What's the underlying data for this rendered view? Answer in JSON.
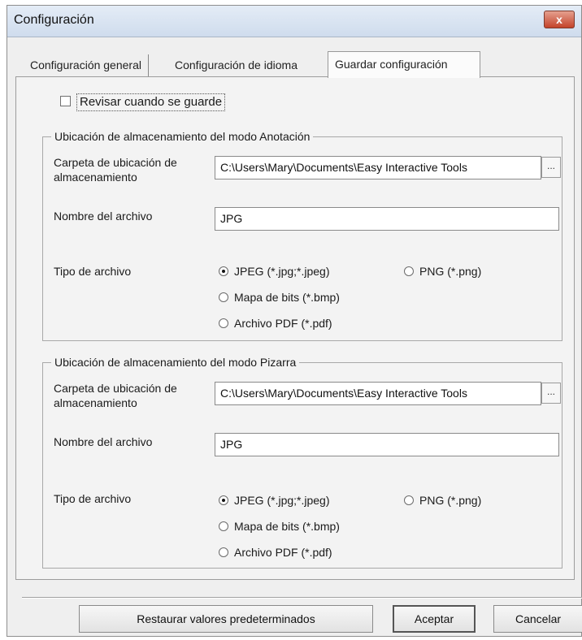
{
  "window": {
    "title": "Configuración",
    "close_label": "x"
  },
  "tabs": [
    {
      "label": "Configuración general"
    },
    {
      "label": "Configuración de idioma"
    },
    {
      "label": "Guardar configuración"
    }
  ],
  "review_checkbox": {
    "label": "Revisar cuando se guarde",
    "checked": false
  },
  "annotation_group": {
    "legend": "Ubicación de almacenamiento del modo Anotación",
    "folder_label": "Carpeta de ubicación de almacenamiento",
    "folder_value": "C:\\Users\\Mary\\Documents\\Easy Interactive Tools",
    "browse_label": "...",
    "filename_label": "Nombre del archivo",
    "filename_value": "JPG",
    "filetype_label": "Tipo de archivo",
    "options": [
      {
        "label": "JPEG (*.jpg;*.jpeg)",
        "selected": true
      },
      {
        "label": "PNG (*.png)",
        "selected": false
      },
      {
        "label": "Mapa de bits (*.bmp)",
        "selected": false
      },
      {
        "label": "Archivo PDF (*.pdf)",
        "selected": false
      }
    ]
  },
  "whiteboard_group": {
    "legend": "Ubicación de almacenamiento del modo Pizarra",
    "folder_label": "Carpeta de ubicación de almacenamiento",
    "folder_value": "C:\\Users\\Mary\\Documents\\Easy Interactive Tools",
    "browse_label": "...",
    "filename_label": "Nombre del archivo",
    "filename_value": "JPG",
    "filetype_label": "Tipo de archivo",
    "options": [
      {
        "label": "JPEG (*.jpg;*.jpeg)",
        "selected": true
      },
      {
        "label": "PNG (*.png)",
        "selected": false
      },
      {
        "label": "Mapa de bits (*.bmp)",
        "selected": false
      },
      {
        "label": "Archivo PDF (*.pdf)",
        "selected": false
      }
    ]
  },
  "buttons": {
    "restore": "Restaurar valores predeterminados",
    "accept": "Aceptar",
    "cancel": "Cancelar"
  }
}
